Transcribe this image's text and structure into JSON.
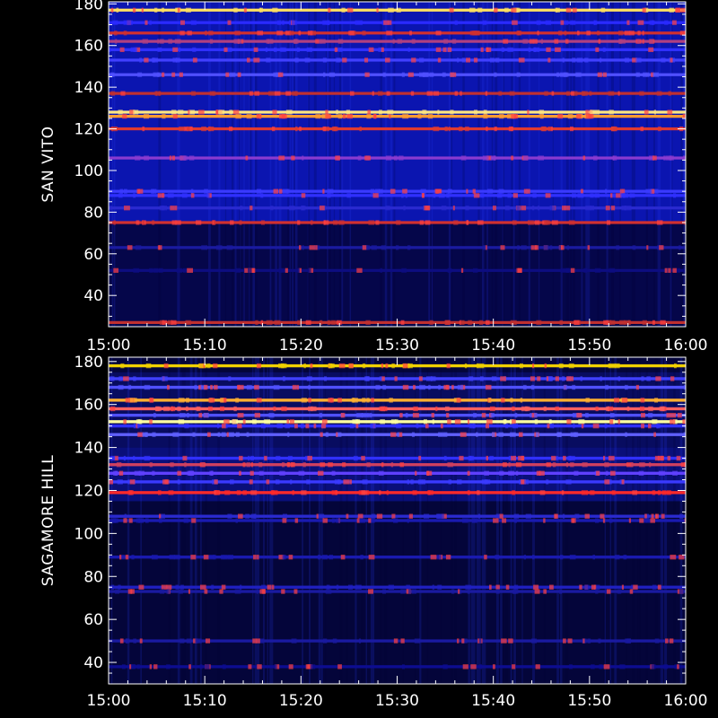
{
  "chart_data": [
    {
      "type": "heatmap",
      "ylabel": "SAN VITO",
      "xlim": [
        "15:00",
        "16:00"
      ],
      "ylim": [
        25,
        181
      ],
      "x_ticks": [
        "15:00",
        "15:10",
        "15:20",
        "15:30",
        "15:40",
        "15:50",
        "16:00"
      ],
      "y_ticks": [
        40,
        60,
        80,
        100,
        120,
        140,
        160,
        180
      ],
      "background_bands": [
        {
          "from": 25,
          "to": 75,
          "color": "#05064a"
        },
        {
          "from": 75,
          "to": 181,
          "color": "#0b15b0"
        }
      ],
      "lines": [
        {
          "y": 177,
          "color": "#ffe060"
        },
        {
          "y": 171,
          "color": "#2a2aff"
        },
        {
          "y": 166,
          "color": "#d03030"
        },
        {
          "y": 162,
          "color": "#b04080"
        },
        {
          "y": 158,
          "color": "#3030ff"
        },
        {
          "y": 153,
          "color": "#4040ff"
        },
        {
          "y": 146,
          "color": "#5050ff"
        },
        {
          "y": 137,
          "color": "#c03030"
        },
        {
          "y": 128,
          "color": "#ffe680"
        },
        {
          "y": 126,
          "color": "#ff9a30"
        },
        {
          "y": 120,
          "color": "#e03a30"
        },
        {
          "y": 106,
          "color": "#8a3ad0"
        },
        {
          "y": 90,
          "color": "#3a3aff"
        },
        {
          "y": 88,
          "color": "#3030ff"
        },
        {
          "y": 82,
          "color": "#2a2ad0"
        },
        {
          "y": 75,
          "color": "#d03030"
        },
        {
          "y": 63,
          "color": "#1a1aa0"
        },
        {
          "y": 52,
          "color": "#0d0d80"
        },
        {
          "y": 27,
          "color": "#c03030"
        }
      ]
    },
    {
      "type": "heatmap",
      "ylabel": "SAGAMORE HILL",
      "xlim": [
        "15:00",
        "16:00"
      ],
      "ylim": [
        30,
        182
      ],
      "x_ticks": [
        "15:00",
        "15:10",
        "15:20",
        "15:30",
        "15:40",
        "15:50",
        "16:00"
      ],
      "y_ticks": [
        40,
        60,
        80,
        100,
        120,
        140,
        160,
        180
      ],
      "background_bands": [
        {
          "from": 30,
          "to": 182,
          "color": "#04053a"
        },
        {
          "from": 115,
          "to": 140,
          "color": "#0a0f7a"
        },
        {
          "from": 140,
          "to": 175,
          "color": "#080c60"
        }
      ],
      "lines": [
        {
          "y": 178,
          "color": "#f0d000"
        },
        {
          "y": 172,
          "color": "#4040ff"
        },
        {
          "y": 168,
          "color": "#5050ff"
        },
        {
          "y": 162,
          "color": "#ffb030"
        },
        {
          "y": 158,
          "color": "#ff6060"
        },
        {
          "y": 155,
          "color": "#5050ff"
        },
        {
          "y": 152,
          "color": "#ffffa0"
        },
        {
          "y": 150,
          "color": "#3030ff"
        },
        {
          "y": 146,
          "color": "#6060ff"
        },
        {
          "y": 135,
          "color": "#3030ff"
        },
        {
          "y": 132,
          "color": "#d04060"
        },
        {
          "y": 128,
          "color": "#6040ff"
        },
        {
          "y": 124,
          "color": "#3a3aff"
        },
        {
          "y": 119,
          "color": "#ff2a2a"
        },
        {
          "y": 108,
          "color": "#2a2ad0"
        },
        {
          "y": 106,
          "color": "#1a1ab0"
        },
        {
          "y": 89,
          "color": "#1a1ab0"
        },
        {
          "y": 75,
          "color": "#2020c0"
        },
        {
          "y": 73,
          "color": "#1a1aa0"
        },
        {
          "y": 50,
          "color": "#1a1aa0"
        },
        {
          "y": 38,
          "color": "#0d0d90"
        }
      ]
    }
  ]
}
